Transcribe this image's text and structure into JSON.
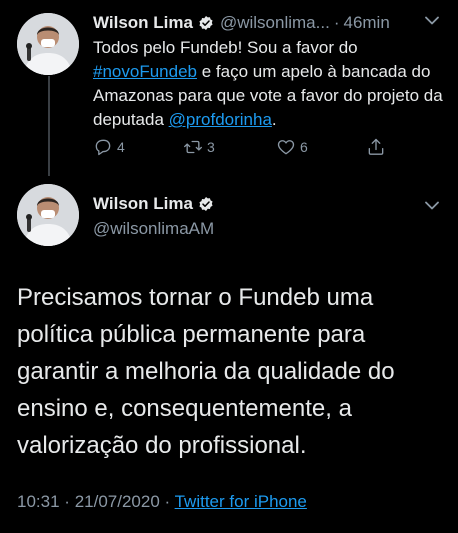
{
  "tweet1": {
    "author_name": "Wilson Lima",
    "handle": "@wilsonlima...",
    "separator": "·",
    "time_ago": "46min",
    "text_parts": {
      "p1": "Todos pelo Fundeb! Sou a favor do ",
      "hashtag": "#novoFundeb",
      "p2": " e faço um apelo à bancada do Amazonas para que vote a favor do projeto da deputada ",
      "mention": "@profdorinha",
      "p3": "."
    },
    "actions": {
      "replies": "4",
      "retweets": "3",
      "likes": "6"
    }
  },
  "tweet2": {
    "author_name": "Wilson Lima",
    "handle": "@wilsonlimaAM",
    "text": "Precisamos tornar o Fundeb uma política pública permanente para garantir a melhoria da qualidade do ensino e, consequentemente, a valorização do profissional.",
    "time": "10:31",
    "separator1": "·",
    "date": "21/07/2020",
    "separator2": "·",
    "source": "Twitter for iPhone"
  },
  "colors": {
    "background": "#000000",
    "text": "#e7e9ea",
    "muted": "#8b98a5",
    "link": "#1d9bf0"
  }
}
